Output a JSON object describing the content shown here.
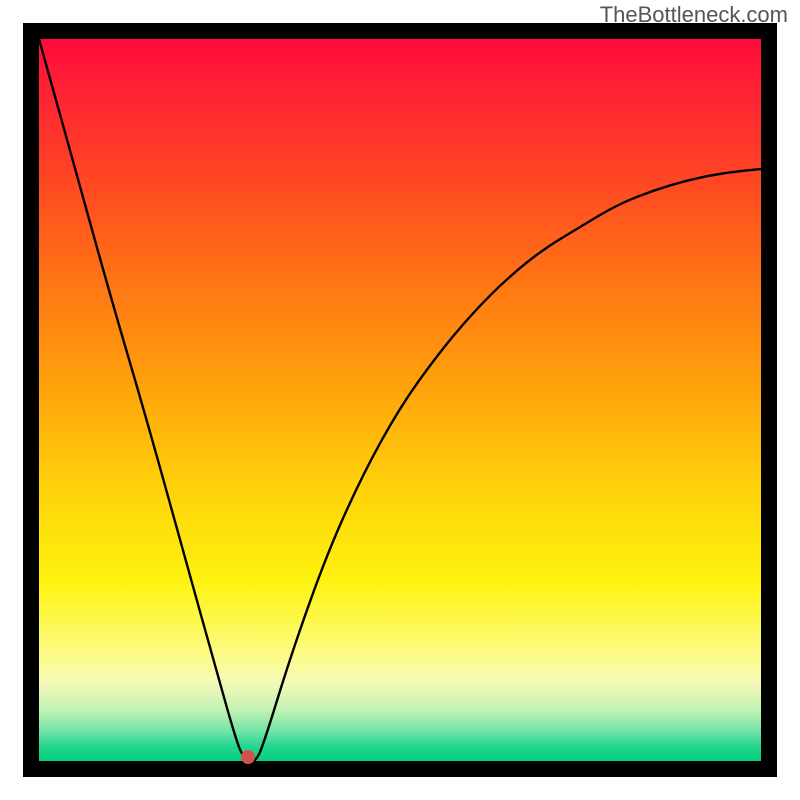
{
  "watermark": "TheBottleneck.com",
  "chart_data": {
    "type": "line",
    "title": "",
    "xlabel": "",
    "ylabel": "",
    "x_range": [
      0,
      100
    ],
    "y_range": [
      0,
      100
    ],
    "grid": false,
    "legend": false,
    "series": [
      {
        "name": "bottleneck-curve",
        "color": "#000000",
        "x": [
          0,
          5,
          10,
          15,
          20,
          25,
          27,
          28,
          29,
          30,
          31,
          35,
          40,
          45,
          50,
          55,
          60,
          65,
          70,
          75,
          80,
          85,
          90,
          95,
          100
        ],
        "values": [
          100,
          82,
          64,
          47,
          29,
          11,
          4,
          1,
          0,
          0,
          2,
          15,
          29,
          40,
          49,
          56,
          62,
          67,
          71,
          74,
          77,
          79,
          80.5,
          81.5,
          82
        ]
      }
    ],
    "annotations": [
      {
        "name": "min-marker",
        "x": 29,
        "y": 0.5,
        "color": "#d4524a"
      }
    ],
    "notes": "Chart has no visible axis tick labels; values are read as percentages of plot width (x) and plot height (y)."
  },
  "colors": {
    "gradient_top": "#ff0b3a",
    "gradient_mid": "#fef20e",
    "gradient_bottom": "#05cf7e",
    "frame": "#000000",
    "curve": "#000000",
    "marker": "#d4524a"
  }
}
